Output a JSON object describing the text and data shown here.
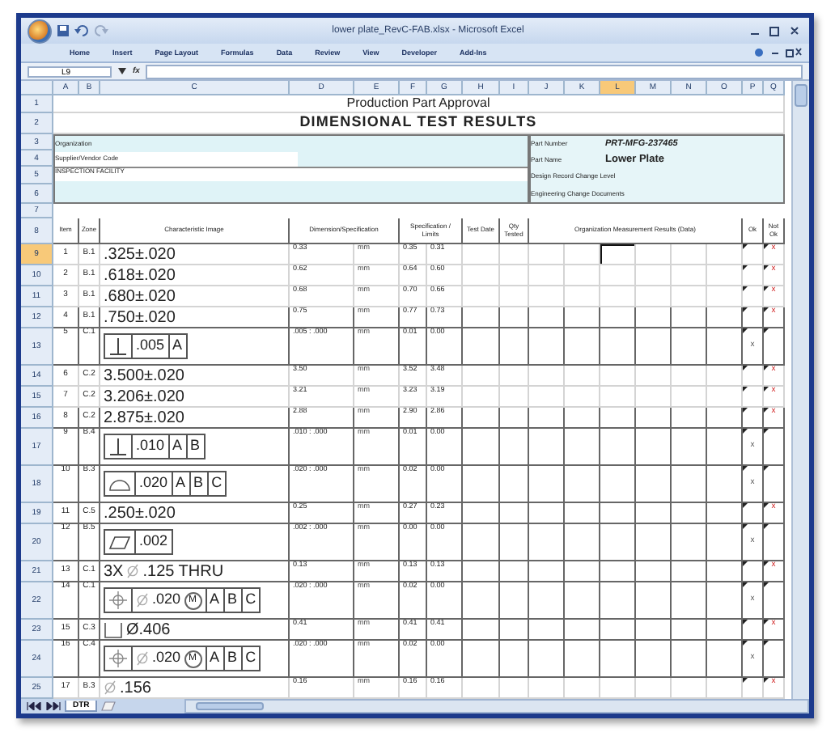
{
  "window": {
    "title": "lower plate_RevC-FAB.xlsx - Microsoft Excel"
  },
  "ribbon_tabs": [
    "Home",
    "Insert",
    "Page Layout",
    "Formulas",
    "Data",
    "Review",
    "View",
    "Developer",
    "Add-Ins"
  ],
  "formula_bar": {
    "name_box": "L9",
    "fx": "fx"
  },
  "columns": [
    {
      "label": "A",
      "selected": false
    },
    {
      "label": "B",
      "selected": false
    },
    {
      "label": "C",
      "selected": false
    },
    {
      "label": "D",
      "selected": false
    },
    {
      "label": "E",
      "selected": false
    },
    {
      "label": "F",
      "selected": false
    },
    {
      "label": "G",
      "selected": false
    },
    {
      "label": "H",
      "selected": false
    },
    {
      "label": "I",
      "selected": false
    },
    {
      "label": "J",
      "selected": false
    },
    {
      "label": "K",
      "selected": false
    },
    {
      "label": "L",
      "selected": true
    },
    {
      "label": "M",
      "selected": false
    },
    {
      "label": "N",
      "selected": false
    },
    {
      "label": "O",
      "selected": false
    },
    {
      "label": "P",
      "selected": false
    },
    {
      "label": "Q",
      "selected": false
    }
  ],
  "top_row_numbers": [
    "1",
    "2",
    "3",
    "4",
    "5",
    "6",
    "7",
    "8"
  ],
  "title": "Production Part Approval",
  "subtitle": "DIMENSIONAL TEST RESULTS",
  "info_left": [
    {
      "label": "Organization"
    },
    {
      "label": "Supplier/Vendor Code"
    },
    {
      "label": "INSPECTION FACILITY"
    }
  ],
  "info_right": [
    {
      "label": "Part Number",
      "value": "PRT-MFG-237465"
    },
    {
      "label": "Part Name",
      "value": "Lower Plate"
    },
    {
      "label": "Design Record Change Level"
    },
    {
      "label": "Engineering Change Documents"
    }
  ],
  "headers": [
    "Item",
    "Zone",
    "Characteristic Image",
    "Dimension/Specification",
    "Specification / Limits",
    "Test Date",
    "Qty Tested",
    "Organization Measurement Results (Data)",
    "Ok",
    "Not Ok"
  ],
  "rows": [
    {
      "number": "9",
      "selected": true,
      "item": "1",
      "zone": "B.1",
      "characteristic": {
        "kind": "plain",
        "parts": [
          {
            "kind": "text",
            "text": ".325±.020"
          }
        ]
      },
      "dimension": "0.33",
      "unit": "mm",
      "upper": "0.35",
      "lower": "0.31",
      "result": {
        "mark": "x",
        "passed": false
      }
    },
    {
      "number": "10",
      "selected": false,
      "item": "2",
      "zone": "B.1",
      "characteristic": {
        "kind": "plain",
        "parts": [
          {
            "kind": "text",
            "text": ".618±.020"
          }
        ]
      },
      "dimension": "0.62",
      "unit": "mm",
      "upper": "0.64",
      "lower": "0.60",
      "result": {
        "mark": "x",
        "passed": false
      }
    },
    {
      "number": "11",
      "selected": false,
      "item": "3",
      "zone": "B.1",
      "characteristic": {
        "kind": "plain",
        "parts": [
          {
            "kind": "text",
            "text": ".680±.020"
          }
        ]
      },
      "dimension": "0.68",
      "unit": "mm",
      "upper": "0.70",
      "lower": "0.66",
      "result": {
        "mark": "x",
        "passed": false
      }
    },
    {
      "number": "12",
      "selected": false,
      "item": "4",
      "zone": "B.1",
      "characteristic": {
        "kind": "plain",
        "parts": [
          {
            "kind": "text",
            "text": ".750±.020"
          }
        ]
      },
      "dimension": "0.75",
      "unit": "mm",
      "upper": "0.77",
      "lower": "0.73",
      "result": {
        "mark": "x",
        "passed": false
      }
    },
    {
      "number": "13",
      "selected": false,
      "item": "5",
      "zone": "C.1",
      "characteristic": {
        "kind": "frame",
        "cells": [
          {
            "kind": "perpendicular"
          },
          {
            "kind": "text",
            "text": ".005"
          },
          {
            "kind": "text",
            "text": "A"
          }
        ]
      },
      "dimension": ".005 : .000",
      "unit": "mm",
      "upper": "0.01",
      "lower": "0.00",
      "result": {
        "mark": "x",
        "passed": true
      }
    },
    {
      "number": "14",
      "selected": false,
      "item": "6",
      "zone": "C.2",
      "characteristic": {
        "kind": "plain",
        "parts": [
          {
            "kind": "text",
            "text": "3.500±.020"
          }
        ]
      },
      "dimension": "3.50",
      "unit": "mm",
      "upper": "3.52",
      "lower": "3.48",
      "result": {
        "mark": "x",
        "passed": false
      }
    },
    {
      "number": "15",
      "selected": false,
      "item": "7",
      "zone": "C.2",
      "characteristic": {
        "kind": "plain",
        "parts": [
          {
            "kind": "text",
            "text": "3.206±.020"
          }
        ]
      },
      "dimension": "3.21",
      "unit": "mm",
      "upper": "3.23",
      "lower": "3.19",
      "result": {
        "mark": "x",
        "passed": false
      }
    },
    {
      "number": "16",
      "selected": false,
      "item": "8",
      "zone": "C.2",
      "characteristic": {
        "kind": "plain",
        "parts": [
          {
            "kind": "text",
            "text": "2.875±.020"
          }
        ]
      },
      "dimension": "2.88",
      "unit": "mm",
      "upper": "2.90",
      "lower": "2.86",
      "result": {
        "mark": "x",
        "passed": false
      }
    },
    {
      "number": "17",
      "selected": false,
      "item": "9",
      "zone": "B.4",
      "characteristic": {
        "kind": "frame",
        "cells": [
          {
            "kind": "perpendicular"
          },
          {
            "kind": "text",
            "text": ".010"
          },
          {
            "kind": "text",
            "text": "A"
          },
          {
            "kind": "text",
            "text": "B"
          }
        ]
      },
      "dimension": ".010 : .000",
      "unit": "mm",
      "upper": "0.01",
      "lower": "0.00",
      "result": {
        "mark": "x",
        "passed": true
      }
    },
    {
      "number": "18",
      "selected": false,
      "item": "10",
      "zone": "B.3",
      "characteristic": {
        "kind": "frame",
        "cells": [
          {
            "kind": "profile"
          },
          {
            "kind": "text",
            "text": ".020"
          },
          {
            "kind": "text",
            "text": "A"
          },
          {
            "kind": "text",
            "text": "B"
          },
          {
            "kind": "text",
            "text": "C"
          }
        ]
      },
      "dimension": ".020 : .000",
      "unit": "mm",
      "upper": "0.02",
      "lower": "0.00",
      "result": {
        "mark": "x",
        "passed": true
      }
    },
    {
      "number": "19",
      "selected": false,
      "item": "11",
      "zone": "C.5",
      "characteristic": {
        "kind": "plain",
        "parts": [
          {
            "kind": "text",
            "text": ".250±.020"
          }
        ]
      },
      "dimension": "0.25",
      "unit": "mm",
      "upper": "0.27",
      "lower": "0.23",
      "result": {
        "mark": "x",
        "passed": false
      }
    },
    {
      "number": "20",
      "selected": false,
      "item": "12",
      "zone": "B.5",
      "characteristic": {
        "kind": "frame",
        "cells": [
          {
            "kind": "flatness"
          },
          {
            "kind": "text",
            "text": ".002"
          }
        ]
      },
      "dimension": ".002 : .000",
      "unit": "mm",
      "upper": "0.00",
      "lower": "0.00",
      "result": {
        "mark": "x",
        "passed": true
      }
    },
    {
      "number": "21",
      "selected": false,
      "item": "13",
      "zone": "C.1",
      "characteristic": {
        "kind": "plain",
        "parts": [
          {
            "kind": "text",
            "text": "3X"
          },
          {
            "kind": "diameter"
          },
          {
            "kind": "text",
            "text": ".125 THRU"
          }
        ]
      },
      "dimension": "0.13",
      "unit": "mm",
      "upper": "0.13",
      "lower": "0.13",
      "result": {
        "mark": "x",
        "passed": false
      }
    },
    {
      "number": "22",
      "selected": false,
      "item": "14",
      "zone": "C.1",
      "characteristic": {
        "kind": "frame",
        "cells": [
          {
            "kind": "position"
          },
          {
            "kind": "diameter_value",
            "text": ".020",
            "modifier": "M"
          },
          {
            "kind": "text",
            "text": "A"
          },
          {
            "kind": "text",
            "text": "B"
          },
          {
            "kind": "text",
            "text": "C"
          }
        ]
      },
      "dimension": ".020 : .000",
      "unit": "mm",
      "upper": "0.02",
      "lower": "0.00",
      "result": {
        "mark": "x",
        "passed": true
      }
    },
    {
      "number": "23",
      "selected": false,
      "item": "15",
      "zone": "C.3",
      "characteristic": {
        "kind": "plain",
        "parts": [
          {
            "kind": "counterbore"
          },
          {
            "kind": "text",
            "text": "Ø.406"
          }
        ]
      },
      "dimension": "0.41",
      "unit": "mm",
      "upper": "0.41",
      "lower": "0.41",
      "result": {
        "mark": "x",
        "passed": false
      }
    },
    {
      "number": "24",
      "selected": false,
      "item": "16",
      "zone": "C.4",
      "characteristic": {
        "kind": "frame",
        "cells": [
          {
            "kind": "position"
          },
          {
            "kind": "diameter_value",
            "text": ".020",
            "modifier": "M"
          },
          {
            "kind": "text",
            "text": "A"
          },
          {
            "kind": "text",
            "text": "B"
          },
          {
            "kind": "text",
            "text": "C"
          }
        ]
      },
      "dimension": ".020 : .000",
      "unit": "mm",
      "upper": "0.02",
      "lower": "0.00",
      "result": {
        "mark": "x",
        "passed": true
      }
    },
    {
      "number": "25",
      "selected": false,
      "item": "17",
      "zone": "B.3",
      "characteristic": {
        "kind": "plain",
        "parts": [
          {
            "kind": "diameter"
          },
          {
            "kind": "text",
            "text": ".156"
          }
        ]
      },
      "dimension": "0.16",
      "unit": "mm",
      "upper": "0.16",
      "lower": "0.16",
      "result": {
        "mark": "x",
        "passed": false
      }
    }
  ],
  "sheet_tabs": [
    {
      "label": "DTR",
      "selected": true
    }
  ]
}
